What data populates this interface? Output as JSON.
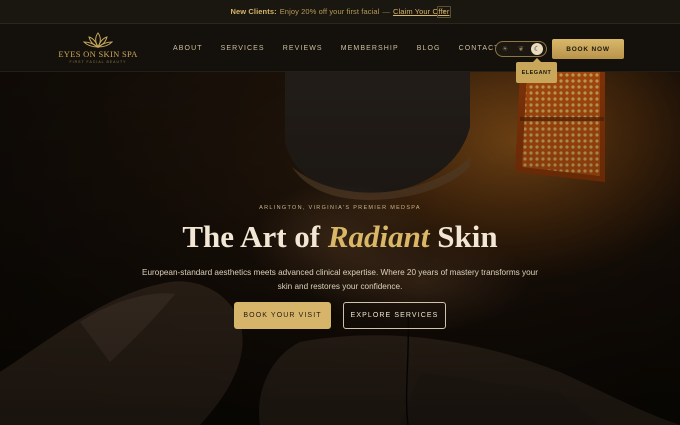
{
  "announcement": {
    "strong": "New Clients:",
    "text": "Enjoy 20% off your first facial",
    "separator": "—",
    "link": "Claim Your Offer",
    "close": "×"
  },
  "brand": {
    "name": "EYES ON SKIN SPA",
    "tagline": "FIRST FACIAL BEAUTY",
    "accent_color": "#d6b46a"
  },
  "nav": {
    "items": [
      "ABOUT",
      "SERVICES",
      "REVIEWS",
      "MEMBERSHIP",
      "BLOG",
      "CONTACT"
    ]
  },
  "theme_toggle": {
    "options": [
      {
        "icon": "sun-icon",
        "glyph": "☀"
      },
      {
        "icon": "leaf-icon",
        "glyph": "❦"
      },
      {
        "icon": "moon-icon",
        "glyph": "☾"
      }
    ],
    "tooltip": "ELEGANT"
  },
  "header_cta": "BOOK NOW",
  "hero": {
    "eyebrow": "ARLINGTON, VIRGINIA'S PREMIER MEDSPA",
    "headline_pre": "The Art of ",
    "headline_accent": "Radiant",
    "headline_post": " Skin",
    "subtext": "European-standard aesthetics meets advanced clinical expertise. Where 20 years of mastery transforms your skin and restores your confidence.",
    "primary_cta": "BOOK YOUR VISIT",
    "secondary_cta": "EXPLORE SERVICES"
  }
}
